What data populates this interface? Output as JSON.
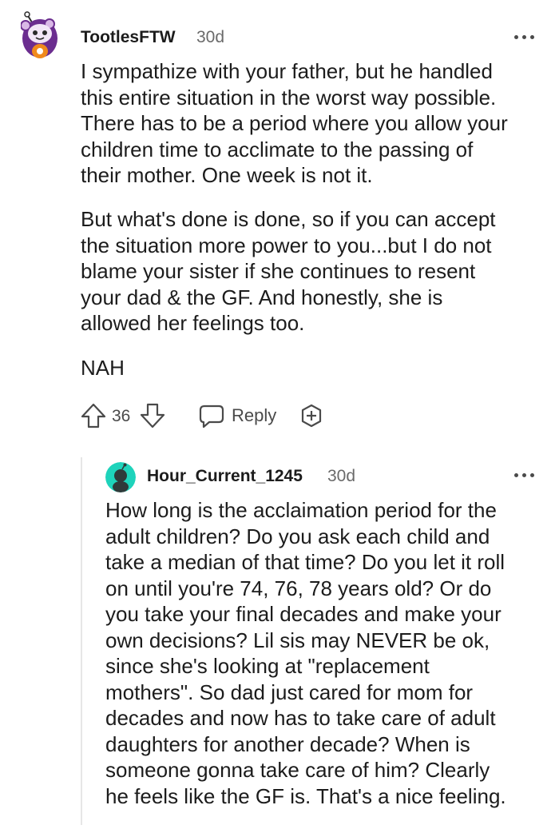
{
  "top_comment": {
    "username": "TootlesFTW",
    "age": "30d",
    "paragraphs": [
      [
        "I sympathize with your father, but he handled",
        "this entire situation in the worst way possible.",
        "There has to be a period where you allow your",
        "children time to acclimate to the passing of",
        "their mother. One week is not it."
      ],
      [
        "But what's done is done, so if you can accept",
        "the situation more power to you...but I do not",
        "blame your sister if she continues to resent",
        "your dad & the GF. And honestly, she is",
        "allowed her feelings too."
      ],
      [
        "NAH"
      ]
    ],
    "score": "36",
    "reply_label": "Reply",
    "icons": {
      "upvote": "arrow-up-icon",
      "downvote": "arrow-down-icon",
      "reply": "speech-bubble-icon",
      "award": "award-plus-icon",
      "more": "ellipsis-icon"
    }
  },
  "reply_comment": {
    "username": "Hour_Current_1245",
    "age": "30d",
    "lines": [
      "How long is the acclaimation period for the",
      "adult children? Do you ask each child and",
      "take a median of that time? Do you let it roll",
      "on until you're 74, 76, 78 years old? Or do",
      "you take your final decades and make your",
      "own decisions? Lil sis may NEVER be ok,",
      "since she's looking at \"replacement",
      "mothers\". So dad just cared for mom for",
      "decades and now has to take care of adult",
      "daughters for another decade? When is",
      "someone gonna take care of him? Clearly",
      "he feels like the GF is. That's a nice feeling."
    ]
  },
  "colors": {
    "text": "#1c1c1c",
    "meta": "#6a6a6a",
    "icon": "#4a4a4a",
    "thread_line": "#e6e6e6",
    "avatar_teal": "#1ed3bb",
    "avatar_purple": "#6b2d8f"
  }
}
